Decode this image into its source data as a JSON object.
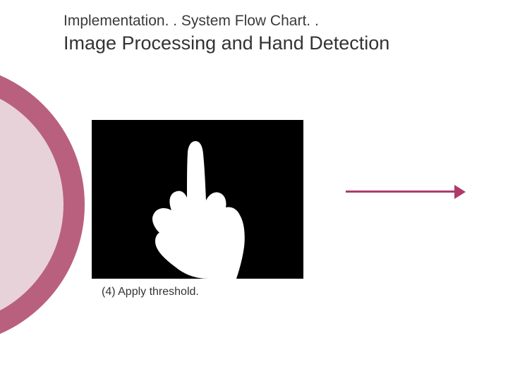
{
  "header": {
    "supertitle": "Implementation. . System Flow Chart. .",
    "title": "Image Processing and Hand Detection"
  },
  "figure": {
    "caption": "(4) Apply threshold.",
    "image_alt": "thresholded-hand-silhouette"
  },
  "colors": {
    "accent": "#b03a6c",
    "ring": "#b9607f",
    "ring_fill": "#e7d2da"
  }
}
